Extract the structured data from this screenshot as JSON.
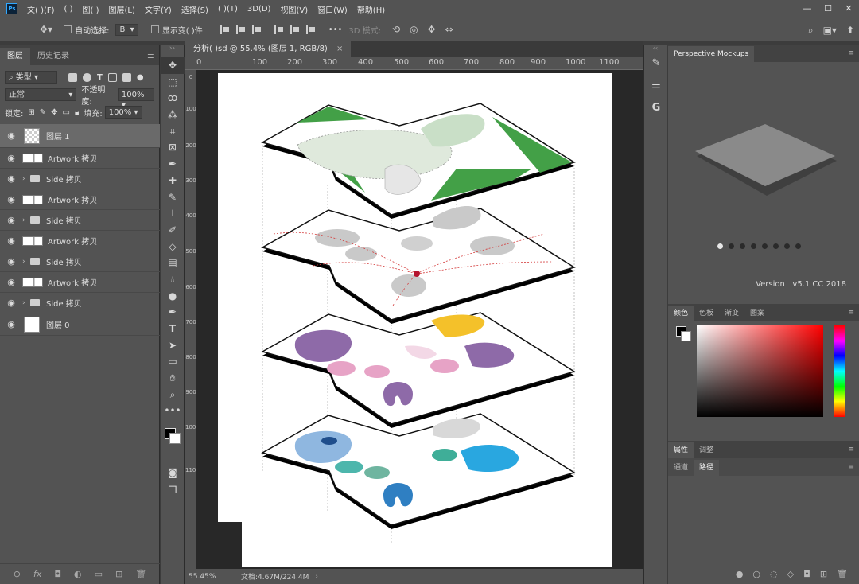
{
  "app": {
    "logo": "Ps",
    "menu": [
      "文( )(F)",
      "( )",
      "图( )",
      "图层(L)",
      "文字(Y)",
      "选择(S)",
      "( )(T)",
      "3D(D)",
      "视图(V)",
      "窗口(W)",
      "帮助(H)"
    ],
    "window_controls": [
      "—",
      "☐",
      "✕"
    ]
  },
  "options": {
    "auto_select_label": "自动选择:",
    "auto_select_value": "B",
    "show_transform_label": "显示变( )件",
    "more": "•••",
    "mode_3d": "3D 模式:"
  },
  "layers_panel": {
    "tabs": [
      "图层",
      "历史记录"
    ],
    "filter_kind": "类型",
    "blend_mode": "正常",
    "opacity_label": "不透明度:",
    "opacity_value": "100%",
    "lock_label": "锁定:",
    "fill_label": "填充:",
    "fill_value": "100%",
    "layers": [
      {
        "name": "图层 1",
        "kind": "transparent",
        "selected": true
      },
      {
        "name": "Artwork 拷贝",
        "kind": "smart"
      },
      {
        "name": "Side 拷贝",
        "kind": "group"
      },
      {
        "name": "Artwork 拷贝",
        "kind": "smart"
      },
      {
        "name": "Side 拷贝",
        "kind": "group"
      },
      {
        "name": "Artwork 拷贝",
        "kind": "smart"
      },
      {
        "name": "Side 拷贝",
        "kind": "group"
      },
      {
        "name": "Artwork 拷贝",
        "kind": "smart"
      },
      {
        "name": "Side 拷贝",
        "kind": "group"
      },
      {
        "name": "图层 0",
        "kind": "white"
      }
    ],
    "footer_icons": [
      "link-icon",
      "fx-icon",
      "mask-icon",
      "adjustment-icon",
      "new-group-icon",
      "new-layer-icon",
      "trash-icon"
    ]
  },
  "document": {
    "tab_title": "分析( )sd @ 55.4% (图层 1, RGB/8)",
    "tab_close": "×",
    "ruler_numbers": [
      "0",
      "100",
      "200",
      "300",
      "400",
      "500",
      "600",
      "700",
      "800",
      "900",
      "1000",
      "1100"
    ],
    "zoom": "55.45%",
    "doc_size": "文档:4.67M/224.4M"
  },
  "right_panels": {
    "plugin_tab": "Perspective Mockups",
    "plugin_version": "Version   v5.1 CC 2018",
    "carousel_dots": 8,
    "color_tabs": [
      "颜色",
      "色板",
      "渐变",
      "图案"
    ],
    "props_tabs": [
      "属性",
      "调整"
    ],
    "channel_tabs": [
      "通道",
      "路径"
    ]
  },
  "colors": {
    "foreground": "#000000",
    "background": "#ffffff",
    "accent_green": "#4caf50",
    "accent_purple": "#8e6aa8",
    "accent_blue": "#2f7fc2"
  }
}
